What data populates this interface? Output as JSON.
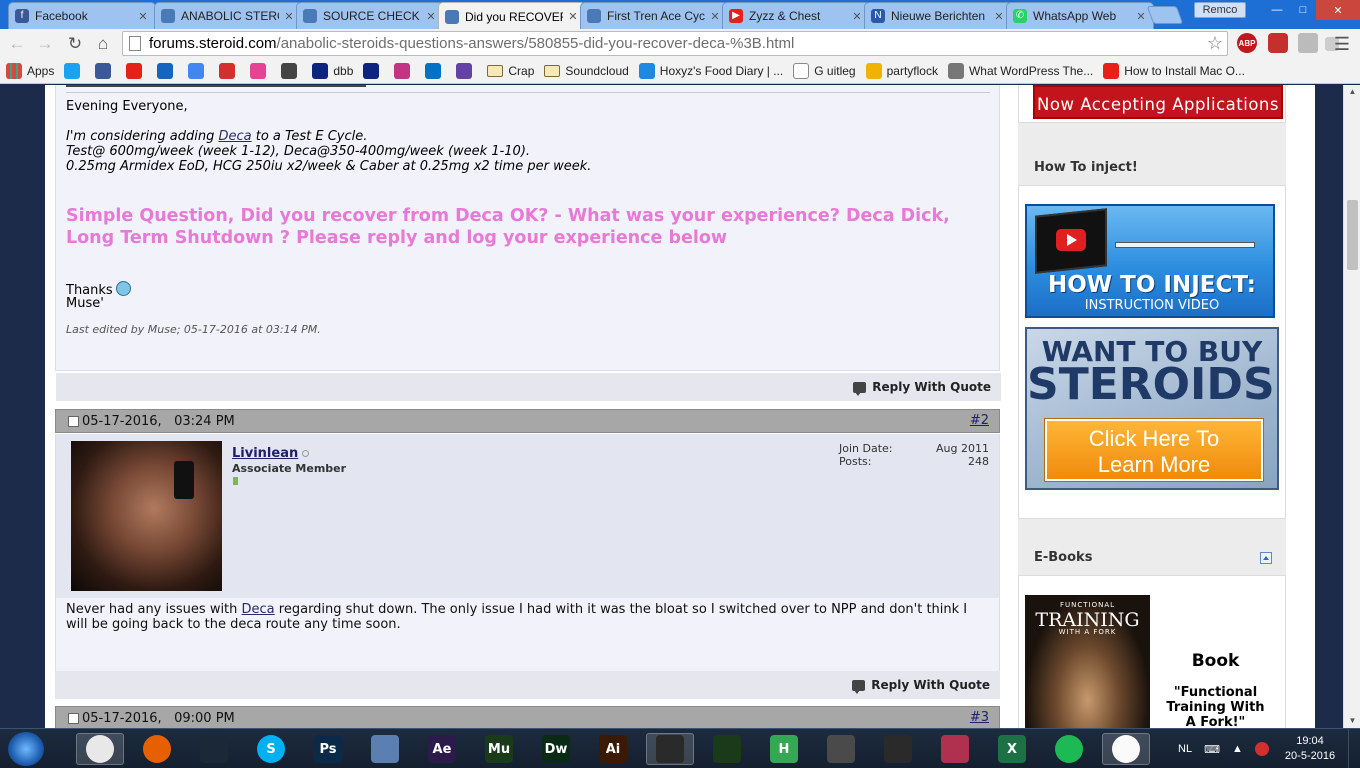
{
  "browser": {
    "tabs": [
      {
        "label": "Facebook",
        "color": "#3b5998",
        "glyph": "f"
      },
      {
        "label": "ANABOLIC STEROIDS",
        "color": "#4a7ab5",
        "glyph": ""
      },
      {
        "label": "SOURCE CHECK",
        "color": "#4a7ab5",
        "glyph": ""
      },
      {
        "label": "Did you RECOVER",
        "color": "#4a7ab5",
        "glyph": "",
        "active": true
      },
      {
        "label": "First Tren Ace Cycle",
        "color": "#4a7ab5",
        "glyph": ""
      },
      {
        "label": "Zyzz & Chest",
        "color": "#e62117",
        "glyph": "▶"
      },
      {
        "label": "Nieuwe Berichten",
        "color": "#2a5aa8",
        "glyph": "N"
      },
      {
        "label": "WhatsApp Web",
        "color": "#25d366",
        "glyph": "✆"
      }
    ],
    "profile_name": "Remco",
    "url_host": "forums.steroid.com",
    "url_path": "/anabolic-steroids-questions-answers/580855-did-you-recover-deca-%3B.html",
    "extensions": [
      "ABP",
      "yt",
      "ext",
      "ext"
    ],
    "bookmarks": [
      {
        "label": "Apps",
        "icon": "apps",
        "color": "#d44"
      },
      {
        "label": "",
        "icon": "twitter",
        "color": "#1da1f2"
      },
      {
        "label": "",
        "icon": "facebook",
        "color": "#3b5998"
      },
      {
        "label": "",
        "icon": "youtube",
        "color": "#e62117"
      },
      {
        "label": "",
        "icon": "af",
        "color": "#1565c0"
      },
      {
        "label": "",
        "icon": "google",
        "color": "#4285f4"
      },
      {
        "label": "",
        "icon": "d",
        "color": "#d32f2f"
      },
      {
        "label": "",
        "icon": "pinwheel",
        "color": "#e84393"
      },
      {
        "label": "",
        "icon": "shield",
        "color": "#444"
      },
      {
        "label": "dbb",
        "icon": "dropbox",
        "color": "#0d2481"
      },
      {
        "label": "",
        "icon": "dropbox",
        "color": "#0d2481"
      },
      {
        "label": "",
        "icon": "instagram",
        "color": "#c13584"
      },
      {
        "label": "",
        "icon": "outlook",
        "color": "#0072c6"
      },
      {
        "label": "",
        "icon": "twitch",
        "color": "#6441a5"
      },
      {
        "label": "Crap",
        "icon": "folder",
        "color": ""
      },
      {
        "label": "Soundcloud",
        "icon": "folder",
        "color": ""
      },
      {
        "label": "Hoxyz's Food Diary | ...",
        "icon": "x",
        "color": "#1e88e5"
      },
      {
        "label": "G uitleg",
        "icon": "page",
        "color": "#fff"
      },
      {
        "label": "partyflock",
        "icon": "partyflock",
        "color": "#f0b400"
      },
      {
        "label": "What WordPress The...",
        "icon": "search",
        "color": "#777"
      },
      {
        "label": "How to Install Mac O...",
        "icon": "youtube",
        "color": "#e62117"
      }
    ]
  },
  "sidebar": {
    "banner_text": "Now Accepting Applications",
    "inject_heading": "How To inject!",
    "inject_ad_title": "HOW TO INJECT:",
    "inject_ad_subtitle": "INSTRUCTION VIDEO",
    "buy_line1": "WANT TO BUY",
    "buy_line2": "STEROIDS?",
    "buy_button_line1": "Click Here To",
    "buy_button_line2": "Learn More",
    "ebooks_heading": "E-Books",
    "book_cover_line1": "FUNCTIONAL",
    "book_cover_line2": "TRAINING",
    "book_cover_line3": "WITH A FORK",
    "book_label": "Book",
    "book_desc": "\"Functional Training With A Fork!\""
  },
  "post1": {
    "greeting": "Evening Everyone,",
    "line1_pre": "I'm considering adding ",
    "line1_link": "Deca",
    "line1_post": " to a Test E Cycle.",
    "line2": "Test@ 600mg/week (week 1-12), Deca@350-400mg/week (week 1-10).",
    "line3": "0.25mg Armidex EoD, HCG 250iu x2/week & Caber at 0.25mg x2 time per week.",
    "question": "Simple Question, Did you recover from Deca OK? - What was your experience? Deca Dick, Long Term Shutdown ? Please reply and log your experience below",
    "thanks": "Thanks",
    "signature": "Muse'",
    "last_edited": "Last edited by Muse; 05-17-2016 at 03:14 PM.",
    "reply_label": "Reply With Quote"
  },
  "post2": {
    "date": "05-17-2016,",
    "time": "03:24 PM",
    "number": "#2",
    "username": "Livinlean",
    "user_title": "Associate Member",
    "join_date_label": "Join Date:",
    "join_date_value": "Aug 2011",
    "posts_label": "Posts:",
    "posts_value": "248",
    "body_pre": "Never had any issues with ",
    "body_link": "Deca",
    "body_post": " regarding shut down. The only issue I had with it was the bloat so I switched over to NPP and don't think I will be going back to the deca route any time soon.",
    "reply_label": "Reply With Quote"
  },
  "post3": {
    "date": "05-17-2016,",
    "time": "09:00 PM",
    "number": "#3"
  },
  "taskbar": {
    "apps": [
      {
        "name": "chrome",
        "label": "",
        "color": "#e8e8e8",
        "active": true
      },
      {
        "name": "firefox",
        "label": "",
        "color": "#e66000"
      },
      {
        "name": "steam",
        "label": "",
        "color": "#1b2838"
      },
      {
        "name": "skype",
        "label": "S",
        "color": "#00aff0"
      },
      {
        "name": "photoshop",
        "label": "Ps",
        "color": "#0b2a4a"
      },
      {
        "name": "keyboard",
        "label": "",
        "color": "#5a7fb0"
      },
      {
        "name": "after-effects",
        "label": "Ae",
        "color": "#2b1a4a"
      },
      {
        "name": "muse",
        "label": "Mu",
        "color": "#1a3b1a"
      },
      {
        "name": "dreamweaver",
        "label": "Dw",
        "color": "#0b2a14"
      },
      {
        "name": "illustrator",
        "label": "Ai",
        "color": "#3a1a05"
      },
      {
        "name": "video-editor",
        "label": "",
        "color": "#2a2a2a",
        "active": true
      },
      {
        "name": "nvidia",
        "label": "",
        "color": "#1a3a1a"
      },
      {
        "name": "h-app",
        "label": "H",
        "color": "#34a853"
      },
      {
        "name": "99",
        "label": "",
        "color": "#4a4a4a"
      },
      {
        "name": "rockstar",
        "label": "",
        "color": "#2a2a2a"
      },
      {
        "name": "game",
        "label": "",
        "color": "#b03050"
      },
      {
        "name": "excel",
        "label": "X",
        "color": "#1e7145"
      },
      {
        "name": "spotify",
        "label": "",
        "color": "#1db954"
      },
      {
        "name": "itunes",
        "label": "",
        "color": "#fafafa",
        "active": true
      }
    ],
    "language": "NL",
    "clock_time": "19:04",
    "clock_date": "20-5-2016"
  }
}
